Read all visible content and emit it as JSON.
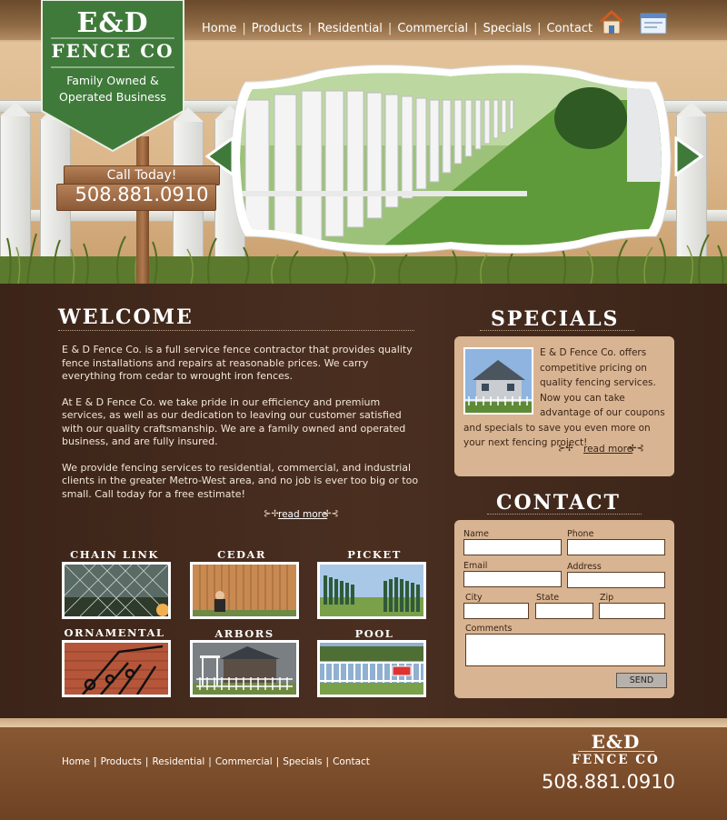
{
  "brand": {
    "line1": "E&D",
    "line2": "FENCE CO",
    "tagline": "Family Owned & Operated Business"
  },
  "nav": {
    "items": [
      "Home",
      "Products",
      "Residential",
      "Commercial",
      "Specials",
      "Contact"
    ],
    "home_icon": "house-icon",
    "mail_icon": "envelope-icon"
  },
  "sign": {
    "call": "Call Today!",
    "phone": "508.881.0910"
  },
  "welcome": {
    "title": "WELCOME",
    "p1": "E & D Fence Co. is a full service fence contractor that provides quality fence installations and repairs at reasonable prices. We carry everything from cedar to wrought iron fences.",
    "p2": "At E & D Fence Co. we take pride in our efficiency and premium services, as well as our dedication to leaving our customer satisfied with our quality craftsmanship. We are a family owned and operated business, and are fully insured.",
    "p3": "We provide fencing services to residential, commercial, and industrial clients in the greater Metro-West area, and no job is ever too big or too small. Call today for a free estimate!",
    "read_more": "read more"
  },
  "categories": [
    "CHAIN LINK",
    "CEDAR",
    "PICKET",
    "ORNAMENTAL",
    "ARBORS",
    "POOL"
  ],
  "specials": {
    "title": "SPECIALS",
    "text": "E & D Fence Co. offers competitive pricing on quality fencing services. Now you can take advantage of our coupons and specials to save you even more on your next fencing project!",
    "read_more": "read more"
  },
  "contact": {
    "title": "CONTACT",
    "name": "Name",
    "phone": "Phone",
    "email": "Email",
    "address": "Address",
    "city": "City",
    "state": "State",
    "zip": "Zip",
    "comments": "Comments",
    "send": "SEND"
  },
  "footer": {
    "nav": [
      "Home",
      "Products",
      "Residential",
      "Commercial",
      "Specials",
      "Contact"
    ],
    "brand1": "E&D",
    "brand2": "FENCE CO",
    "phone": "508.881.0910"
  },
  "colors": {
    "green": "#3f7a3a",
    "tan_panel": "#d8b492",
    "dark_brown": "#3b2418"
  }
}
